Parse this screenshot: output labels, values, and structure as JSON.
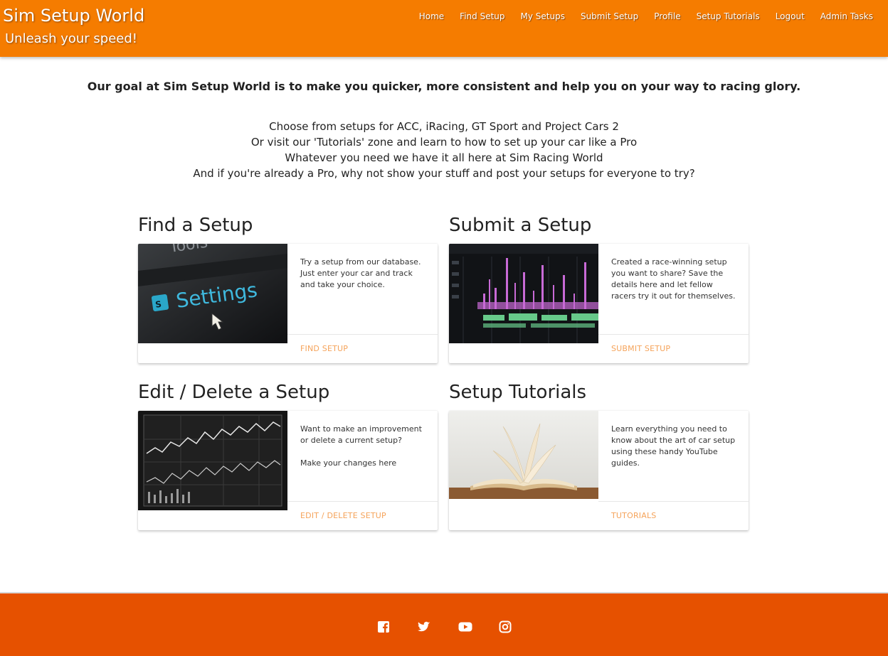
{
  "header": {
    "title": "Sim Setup World",
    "tagline": "Unleash your speed!",
    "nav": [
      "Home",
      "Find Setup",
      "My Setups",
      "Submit Setup",
      "Profile",
      "Setup Tutorials",
      "Logout",
      "Admin Tasks"
    ]
  },
  "intro": {
    "lead": "Our goal at Sim Setup World is to make you quicker, more consistent and help you on your way to racing glory.",
    "lines": [
      "Choose from setups for ACC, iRacing, GT Sport and Project Cars 2",
      "Or visit our 'Tutorials' zone and learn to how to set up your car like a Pro",
      "Whatever you need we have it all here at Sim Racing World",
      "And if you're already a Pro, why not show your stuff and post your setups for everyone to try?"
    ]
  },
  "sections": [
    {
      "title": "Find a Setup",
      "image_icon": "settings-screen-image",
      "text": [
        "Try a setup from our database. Just enter your car and track and take your choice."
      ],
      "action": "Find Setup"
    },
    {
      "title": "Submit a Setup",
      "image_icon": "editing-timeline-image",
      "text": [
        "Created a race-winning setup you want to share? Save the details here and let fellow racers try it out for themselves."
      ],
      "action": "Submit Setup"
    },
    {
      "title": "Edit / Delete a Setup",
      "image_icon": "stock-chart-screen-image",
      "text": [
        "Want to make an improvement or delete a current setup?",
        "Make your changes here"
      ],
      "action": "Edit / Delete Setup"
    },
    {
      "title": "Setup Tutorials",
      "image_icon": "open-book-image",
      "text": [
        "Learn everything you need to know about the art of car setup using these handy YouTube guides."
      ],
      "action": "Tutorials"
    }
  ],
  "footer": {
    "social": [
      "facebook-icon",
      "twitter-icon",
      "youtube-icon",
      "instagram-icon"
    ]
  },
  "colors": {
    "header": "#f57c00",
    "footer": "#e65100",
    "action_link": "#f5a35a"
  }
}
